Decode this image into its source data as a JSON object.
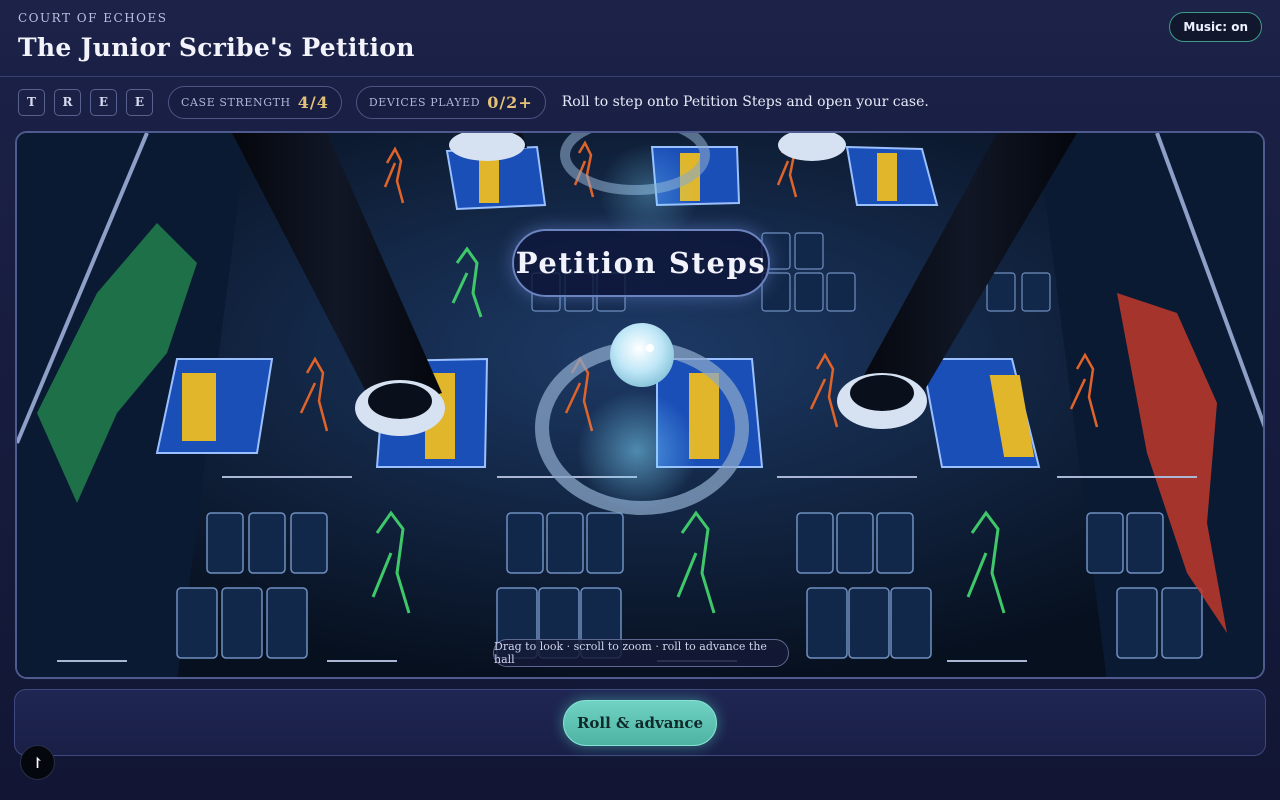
{
  "header": {
    "eyebrow": "COURT OF ECHOES",
    "title": "The Junior Scribe's Petition",
    "music_label": "Music: on"
  },
  "toolbar": {
    "letters": [
      "T",
      "R",
      "E",
      "E"
    ],
    "case_strength": {
      "label": "CASE STRENGTH",
      "value": "4/4"
    },
    "devices_played": {
      "label": "DEVICES PLAYED",
      "value": "0/2+"
    },
    "hint": "Roll to step onto Petition Steps and open your case."
  },
  "viewport": {
    "location_label": "Petition Steps",
    "controls_hint": "Drag to look · scroll to zoom · roll to advance the hall"
  },
  "actions": {
    "roll_label": "Roll & advance"
  },
  "fab": {
    "icon": "cursor-icon",
    "glyph": "↾"
  },
  "colors": {
    "accent": "#5fc3b3",
    "gold": "#e3c278",
    "court_blue": "#1b4fb8",
    "court_yellow": "#e1b62a",
    "figure_orange": "#e0642a",
    "figure_green": "#3fc86a",
    "figure_red": "#c0392b"
  }
}
